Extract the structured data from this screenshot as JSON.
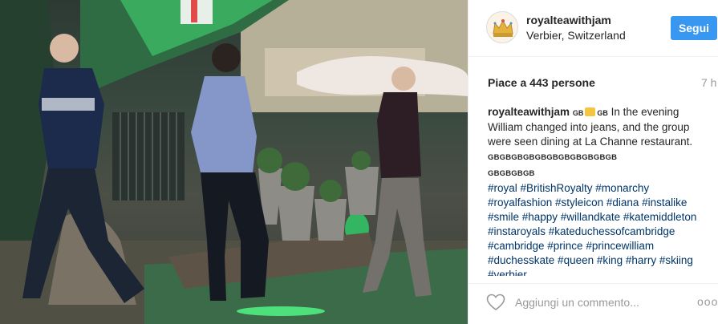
{
  "header": {
    "username": "royalteawithjam",
    "location": "Verbier, Switzerland",
    "follow_label": "Segui"
  },
  "stats": {
    "likes": "Piace a 443 persone",
    "time": "7 h"
  },
  "caption": {
    "username": "royalteawithjam",
    "flag_left": "GB",
    "flag_right": "GB",
    "text": "In the evening William changed into jeans, and the group were seen dining at La Channe restaurant.",
    "flags_run_1": "GBGBGBGBGBGBGBGBGBGBGB",
    "flags_run_2": "GBGBGBGB",
    "hashtags": "#royal #BritishRoyalty #monarchy #royalfashion #styleicon #diana #instalike #smile #happy #willandkate #katemiddleton #instaroyals #kateduchessofcambridge #cambridge #prince #princewilliam #duchesskate #queen #king #harry #skiing #verbier"
  },
  "footer": {
    "comment_placeholder": "Aggiungi un commento...",
    "more_label": "ooo"
  },
  "icons": {
    "avatar": "crown-avatar-icon",
    "like": "heart-icon",
    "more": "more-options-icon"
  },
  "colors": {
    "follow_button": "#3897f0",
    "hashtag": "#003569",
    "muted": "#999999"
  }
}
